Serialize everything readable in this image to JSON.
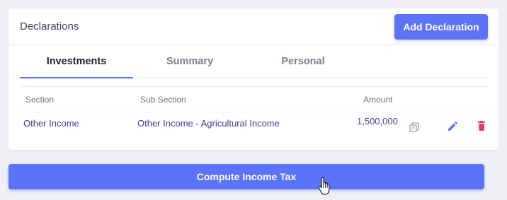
{
  "card": {
    "title": "Declarations",
    "add_button_label": "Add Declaration"
  },
  "tabs": [
    {
      "label": "Investments",
      "active": true
    },
    {
      "label": "Summary",
      "active": false
    },
    {
      "label": "Personal",
      "active": false
    }
  ],
  "table": {
    "headers": {
      "section": "Section",
      "sub_section": "Sub Section",
      "amount": "Amount"
    },
    "rows": [
      {
        "section": "Other Income",
        "sub_section": "Other Income - Agricultural Income",
        "amount": "1,500,000",
        "actions": [
          "copy-icon",
          "edit-icon",
          "delete-icon"
        ]
      }
    ]
  },
  "compute_button_label": "Compute Income Tax",
  "colors": {
    "accent": "#5b73f8",
    "background": "#eef0f6",
    "link_text": "#3a4290",
    "delete": "#f0306a",
    "copy_icon": "#9aa0b4"
  }
}
